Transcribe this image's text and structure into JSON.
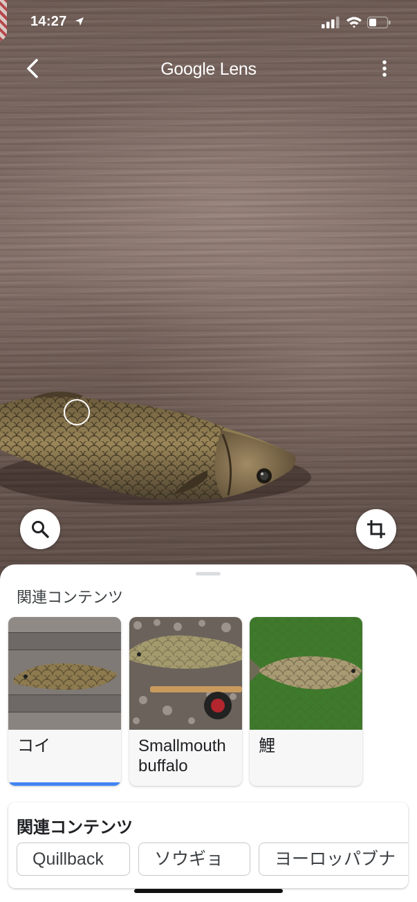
{
  "status_bar": {
    "time": "14:27",
    "icons": [
      "location-arrow-icon",
      "signal-icon",
      "wifi-icon",
      "battery-icon"
    ]
  },
  "header": {
    "title": "Google Lens",
    "back_icon": "chevron-left-icon",
    "menu_icon": "more-vertical-icon"
  },
  "photo": {
    "subject": "fish on wooden boards",
    "colors": {
      "wood": "#7d6963",
      "fish": "#8a7448"
    }
  },
  "floating_buttons": {
    "left": "search-icon",
    "right": "crop-icon"
  },
  "sheet": {
    "heading": "関連コンテンツ",
    "results": [
      {
        "label": "コイ",
        "selected": true
      },
      {
        "label": "Smallmouth buffalo",
        "selected": false
      },
      {
        "label": "鯉",
        "selected": false
      }
    ],
    "related": {
      "title": "関連コンテンツ",
      "chips": [
        "Quillback",
        "ソウギョ",
        "ヨーロッパブナ"
      ]
    }
  },
  "accent_color": "#4285f4"
}
